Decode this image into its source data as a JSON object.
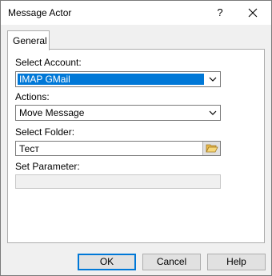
{
  "window": {
    "title": "Message Actor",
    "help_glyph": "?"
  },
  "tabs": [
    {
      "label": "General"
    }
  ],
  "form": {
    "account_label": "Select Account:",
    "account_value": "IMAP GMail",
    "actions_label": "Actions:",
    "actions_value": "Move Message",
    "folder_label": "Select Folder:",
    "folder_value": "Тест",
    "parameter_label": "Set Parameter:",
    "parameter_value": ""
  },
  "buttons": {
    "ok": "OK",
    "cancel": "Cancel",
    "help": "Help"
  },
  "colors": {
    "selection": "#0078d7",
    "dialog_bg": "#f0f0f0"
  },
  "icons": {
    "close": "close-icon",
    "dropdown": "chevron-down-icon",
    "browse": "folder-open-icon"
  }
}
